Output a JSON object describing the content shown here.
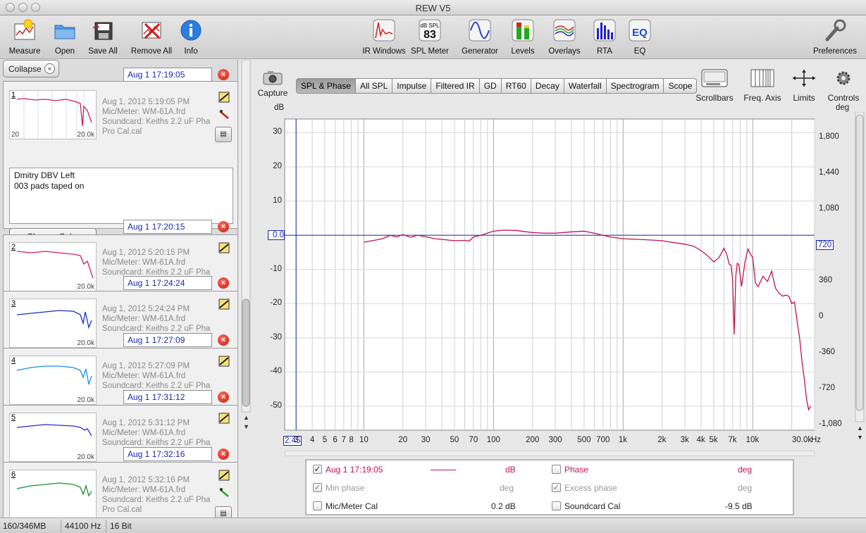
{
  "window": {
    "title": "REW V5"
  },
  "toolbar": {
    "measure": "Measure",
    "open": "Open",
    "save_all": "Save All",
    "remove_all": "Remove All",
    "info": "Info",
    "ir_windows": "IR Windows",
    "spl_meter": "SPL Meter",
    "spl_meter_badge_top": "dB SPL",
    "spl_meter_badge_value": "83",
    "generator": "Generator",
    "levels": "Levels",
    "overlays": "Overlays",
    "rta": "RTA",
    "eq": "EQ",
    "eq_badge": "EQ",
    "preferences": "Preferences"
  },
  "sidebar": {
    "collapse_label": "Collapse",
    "measurements": [
      {
        "num": "1",
        "tab_title": "Aug 1 17:19:05",
        "date": "Aug 1, 2012 5:19:05 PM",
        "mic": "Mic/Meter: WM-61A.frd",
        "soundcard": "Soundcard: Keiths 2.2 uF Pha Pro Cal.cal",
        "color": "#cc1f5c",
        "thumb_lo": "20",
        "thumb_hi": "20.0k",
        "notes_line1": "Dmitry DBV Left",
        "notes_line2": "003 pads taped on",
        "change_cal": "Change Cal..."
      },
      {
        "num": "2",
        "tab_title": "Aug 1 17:20:15",
        "date": "Aug 1, 2012 5:20:15 PM",
        "mic": "Mic/Meter: WM-61A.frd",
        "soundcard": "Soundcard: Keiths 2.2 uF Pha",
        "color": "#d81b6a",
        "thumb_hi": "20.0k"
      },
      {
        "num": "3",
        "tab_title": "Aug 1 17:24:24",
        "date": "Aug 1, 2012 5:24:24 PM",
        "mic": "Mic/Meter: WM-61A.frd",
        "soundcard": "Soundcard: Keiths 2.2 uF Pha",
        "color": "#1230c8",
        "thumb_hi": "20.0k"
      },
      {
        "num": "4",
        "tab_title": "Aug 1 17:27:09",
        "date": "Aug 1, 2012 5:27:09 PM",
        "mic": "Mic/Meter: WM-61A.frd",
        "soundcard": "Soundcard: Keiths 2.2 uF Pha",
        "color": "#1e8fe0",
        "thumb_hi": "20.0k"
      },
      {
        "num": "5",
        "tab_title": "Aug 1 17:31:12",
        "date": "Aug 1, 2012 5:31:12 PM",
        "mic": "Mic/Meter: WM-61A.frd",
        "soundcard": "Soundcard: Keiths 2.2 uF Pha",
        "color": "#2a2ad0",
        "thumb_hi": "20.0k"
      },
      {
        "num": "6",
        "tab_title": "Aug 1 17:32:16",
        "date": "Aug 1, 2012 5:32:16 PM",
        "mic": "Mic/Meter: WM-61A.frd",
        "soundcard": "Soundcard: Keiths 2.2 uF Pha Pro Cal.cal",
        "color": "#1a9030"
      }
    ]
  },
  "graph_header": {
    "capture": "Capture",
    "tabs": [
      "SPL & Phase",
      "All SPL",
      "Impulse",
      "Filtered IR",
      "GD",
      "RT60",
      "Decay",
      "Waterfall",
      "Spectrogram",
      "Scope"
    ],
    "active_tab": "SPL & Phase",
    "scrollbars": "Scrollbars",
    "freq_axis": "Freq. Axis",
    "limits": "Limits",
    "controls": "Controls"
  },
  "chart_data": {
    "type": "line",
    "x_scale": "log",
    "xlim": [
      2.45,
      30000
    ],
    "ylim": [
      -57,
      34
    ],
    "y2lim": [
      -1140,
      1980
    ],
    "ylabel": "dB",
    "y2label": "deg",
    "xunit": "Hz",
    "x_tick_labels": [
      "2.45",
      "3",
      "4",
      "5",
      "6",
      "7",
      "8",
      "10",
      "20",
      "30",
      "50",
      "70",
      "100",
      "200",
      "300",
      "500",
      "700",
      "1k",
      "2k",
      "3k",
      "4k",
      "5k",
      "7k",
      "10k",
      "30.0k"
    ],
    "x_tick_values": [
      2.45,
      3,
      4,
      5,
      6,
      7,
      8,
      10,
      20,
      30,
      50,
      70,
      100,
      200,
      300,
      500,
      700,
      1000,
      2000,
      3000,
      4000,
      5000,
      7000,
      10000,
      30000
    ],
    "y_ticks": [
      "30",
      "20",
      "10",
      "0.0",
      "-10",
      "-20",
      "-30",
      "-40",
      "-50"
    ],
    "y_tick_values": [
      30,
      20,
      10,
      0,
      -10,
      -20,
      -30,
      -40,
      -50
    ],
    "y2_ticks": [
      "1,800",
      "1,440",
      "1,080",
      "720",
      "360",
      "0",
      "-360",
      "-720",
      "-1,080"
    ],
    "y2_tick_values": [
      1800,
      1440,
      1080,
      720,
      360,
      0,
      -360,
      -720,
      -1080
    ],
    "cursor_x": 3.0,
    "reference_y": 0.0,
    "series": [
      {
        "name": "Aug 1 17:19:05",
        "color": "#c0144e",
        "x": [
          10,
          12,
          14,
          16,
          18,
          20,
          23,
          26,
          30,
          35,
          40,
          50,
          60,
          65,
          70,
          80,
          100,
          120,
          150,
          200,
          250,
          300,
          400,
          500,
          600,
          800,
          1000,
          1500,
          2000,
          2500,
          3000,
          3500,
          4000,
          4500,
          5000,
          5500,
          6000,
          6300,
          6600,
          6800,
          7000,
          7200,
          7400,
          7600,
          7800,
          8200,
          8700,
          9200,
          9600,
          10000,
          10500,
          11000,
          12000,
          13000,
          14000,
          15000,
          16000,
          17000,
          18000,
          19000,
          20000,
          21000,
          22000,
          23000,
          24000,
          25000,
          26000,
          27000,
          28000
        ],
        "y": [
          -2,
          -1.5,
          -1,
          0,
          -0.5,
          0.2,
          -0.6,
          0,
          -0.4,
          -1,
          -1.2,
          -1.6,
          -1.5,
          -1.7,
          -0.5,
          0,
          1.2,
          1.5,
          1.4,
          0.8,
          0.6,
          0.6,
          1.0,
          1.2,
          0.6,
          -0.5,
          -1.0,
          -1.3,
          -1.6,
          -2.2,
          -2.6,
          -3.2,
          -4.5,
          -6.0,
          -7.8,
          -6.5,
          -3.8,
          -5.5,
          -8.5,
          -8.7,
          -13,
          -29,
          -12,
          -8.2,
          -8.5,
          -15,
          -8,
          -4,
          -5.5,
          -6.5,
          -14,
          -15,
          -12,
          -13.5,
          -10.5,
          -15.5,
          -17,
          -17.8,
          -17.5,
          -17.8,
          -20,
          -19.5,
          -25,
          -30,
          -37,
          -42,
          -48,
          -51,
          -50
        ]
      }
    ]
  },
  "legend": {
    "series_name": "Aug 1 17:19:05",
    "series_unit": "dB",
    "series_color": "#c0144e",
    "series_checked": true,
    "phase": "Phase",
    "phase_unit": "deg",
    "phase_checked": false,
    "min_phase": "Min phase",
    "min_phase_unit": "deg",
    "min_phase_checked": true,
    "excess_phase": "Excess phase",
    "excess_phase_unit": "deg",
    "excess_phase_checked": true,
    "mic_cal": "Mic/Meter Cal",
    "mic_cal_value": "0.2 dB",
    "mic_cal_checked": false,
    "soundcard_cal": "Soundcard Cal",
    "soundcard_cal_value": "-9.5 dB",
    "soundcard_cal_checked": false
  },
  "status": {
    "memory": "160/346MB",
    "sample_rate": "44100 Hz",
    "bit_depth": "16 Bit"
  }
}
